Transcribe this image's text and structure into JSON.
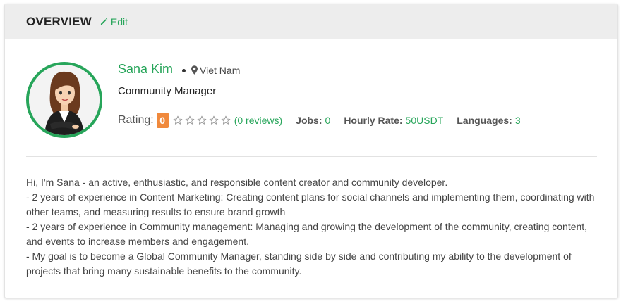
{
  "header": {
    "title": "OVERVIEW",
    "edit_label": "Edit"
  },
  "profile": {
    "name": "Sana Kim",
    "location": "Viet Nam",
    "role": "Community Manager"
  },
  "stats": {
    "rating_label": "Rating:",
    "rating_value": "0",
    "stars_filled": 0,
    "stars_total": 5,
    "reviews": "(0 reviews)",
    "jobs_label": "Jobs:",
    "jobs_value": "0",
    "rate_label": "Hourly Rate:",
    "rate_value": "50USDT",
    "languages_label": "Languages:",
    "languages_value": "3"
  },
  "bio": [
    "Hi, I'm Sana - an active, enthusiastic, and responsible content creator and community developer.",
    "- 2 years of experience in Content Marketing: Creating content plans for social channels and implementing them, coordinating with other teams, and measuring results to ensure brand growth",
    "- 2 years of experience in Community management: Managing and growing the development of the community, creating content, and events to increase members and engagement.",
    "- My goal is to become a Global Community Manager, standing side by side and contributing my ability to the development of projects that bring many sustainable benefits to the community."
  ],
  "colors": {
    "accent": "#27a55a",
    "badge": "#f0893c"
  },
  "icons": {
    "edit": "pencil-icon",
    "location": "map-marker-icon",
    "star": "star-outline-icon"
  }
}
